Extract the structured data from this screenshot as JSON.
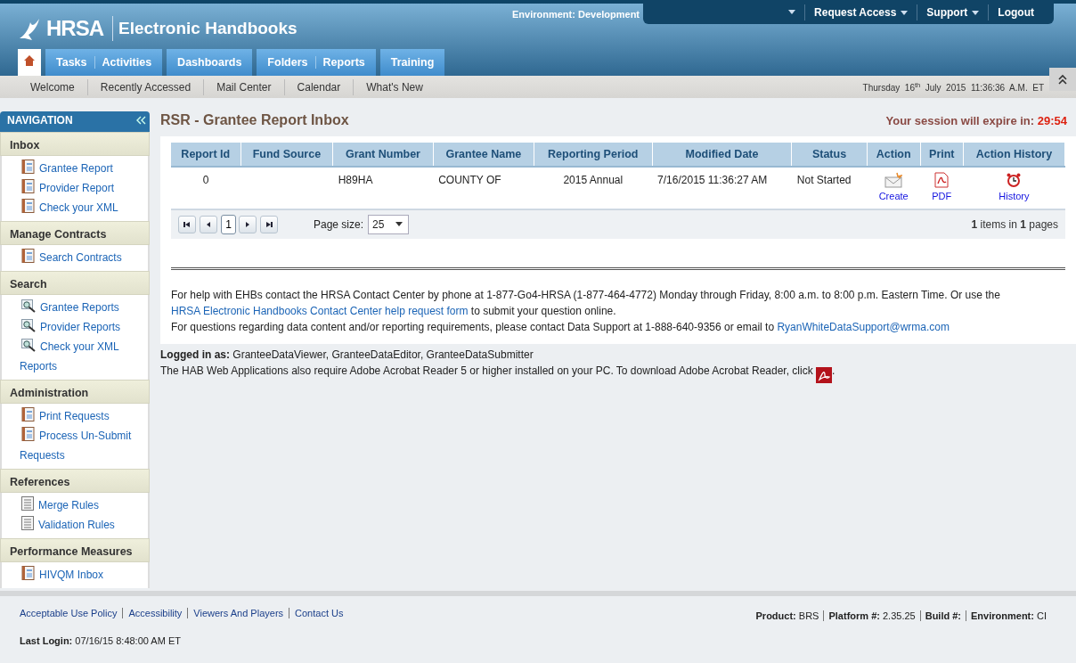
{
  "header": {
    "logo_text": "HRSA",
    "app_title": "Electronic Handbooks",
    "environment": "Environment: Development",
    "top_links": [
      {
        "label": "Request Access",
        "dropdown": true
      },
      {
        "label": "Support",
        "dropdown": true
      },
      {
        "label": "Logout",
        "dropdown": false
      }
    ]
  },
  "home_tab": {
    "selected": true
  },
  "tab_groups": [
    [
      {
        "label": "Tasks",
        "selected": false
      },
      {
        "label": "Activities",
        "selected": false
      }
    ],
    [
      {
        "label": "Dashboards",
        "selected": false
      }
    ],
    [
      {
        "label": "Folders",
        "selected": false
      },
      {
        "label": "Reports",
        "selected": false
      }
    ],
    [
      {
        "label": "Training",
        "selected": false
      }
    ]
  ],
  "subnav": [
    "Welcome",
    "Recently Accessed",
    "Mail Center",
    "Calendar",
    "What's New"
  ],
  "datetime": "Thursday  16$^{th}$  July  2015  11:36:36  A.M.  ET",
  "sidebar": {
    "title": "NAVIGATION",
    "sections": [
      {
        "title": "Inbox",
        "items": [
          {
            "label": "Grantee Report",
            "kind": "report"
          },
          {
            "label": "Provider Report",
            "kind": "report"
          },
          {
            "label": "Check your XML",
            "kind": "report"
          }
        ]
      },
      {
        "title": "Manage Contracts",
        "items": [
          {
            "label": "Search Contracts",
            "kind": "report"
          }
        ]
      },
      {
        "title": "Search",
        "items": [
          {
            "label": "Grantee Reports",
            "kind": "search"
          },
          {
            "label": "Provider Reports",
            "kind": "search"
          },
          {
            "label": "Check your XML Reports",
            "kind": "search"
          }
        ]
      },
      {
        "title": "Administration",
        "items": [
          {
            "label": "Print Requests",
            "kind": "report"
          },
          {
            "label": "Process Un-Submit Requests",
            "kind": "report"
          }
        ]
      },
      {
        "title": "References",
        "items": [
          {
            "label": "Merge Rules",
            "kind": "document"
          },
          {
            "label": "Validation Rules",
            "kind": "document"
          }
        ]
      },
      {
        "title": "Performance Measures",
        "items": [
          {
            "label": "HIVQM Inbox",
            "kind": "report"
          }
        ]
      }
    ]
  },
  "page_title": "RSR - Grantee Report Inbox",
  "session": {
    "label": "Your session will expire in:",
    "time": "29:54"
  },
  "table": {
    "columns": [
      "Report Id",
      "Fund Source",
      "Grant Number",
      "Grantee Name",
      "Reporting Period",
      "Modified Date",
      "Status",
      "Action",
      "Print",
      "Action History"
    ],
    "rows": [
      {
        "cells": [
          {
            "kind": "text",
            "text": "0"
          },
          {
            "kind": "blank"
          },
          {
            "kind": "text",
            "text": "H89HA"
          },
          {
            "kind": "text",
            "text": "COUNTY OF"
          },
          {
            "kind": "text",
            "text": "2015 Annual"
          },
          {
            "kind": "text",
            "text": "7/16/2015 11:36:27 AM"
          },
          {
            "kind": "text",
            "text": "Not Started"
          },
          {
            "kind": "envelope",
            "text": "Create"
          },
          {
            "kind": "pdf",
            "text": "PDF"
          },
          {
            "kind": "clock",
            "text": "History"
          }
        ]
      }
    ]
  },
  "pager": {
    "current_page": "1",
    "page_size_label": "Page size:",
    "page_size": "25",
    "summary": "**1** items in **1** pages"
  },
  "help": [
    [
      {
        "text": "For help with EHBs contact the HRSA Contact Center by phone at 1-877-Go4-HRSA (1-877-464-4772) Monday through Friday, 8:00 a.m. to 8:00 p.m. Eastern Time. Or use the"
      },
      {
        "link": "HRSA Electronic Handbooks Contact Center help request form"
      },
      {
        "text": "to submit your question online."
      }
    ],
    [
      {
        "text": "For questions regarding data content and/or reporting requirements, please contact Data Support at 1-888-640-9356 or email to"
      },
      {
        "link": "RyanWhiteDataSupport@wrma.com"
      }
    ]
  ],
  "logged_in": "**Logged in as:** GranteeDataViewer, GranteeDataEditor, GranteeDataSubmitter",
  "acrobat_note": {
    "text": "The HAB Web Applications also require Adobe Acrobat Reader 5 or higher installed on your PC. To download Adobe Acrobat Reader, click",
    "after": "."
  },
  "footer": {
    "links": [
      "Acceptable Use Policy",
      "Accessibility",
      "Viewers And Players",
      "Contact Us"
    ],
    "product_info": [
      {
        "label": "Product:",
        "value": "BRS"
      },
      {
        "label": "Platform #:",
        "value": "2.35.25"
      },
      {
        "label": "Build #:"
      },
      {
        "label": "Environment:",
        "value": "CI"
      }
    ],
    "last_login": "**Last Login:** 07/16/15 8:48:00 AM ET"
  }
}
